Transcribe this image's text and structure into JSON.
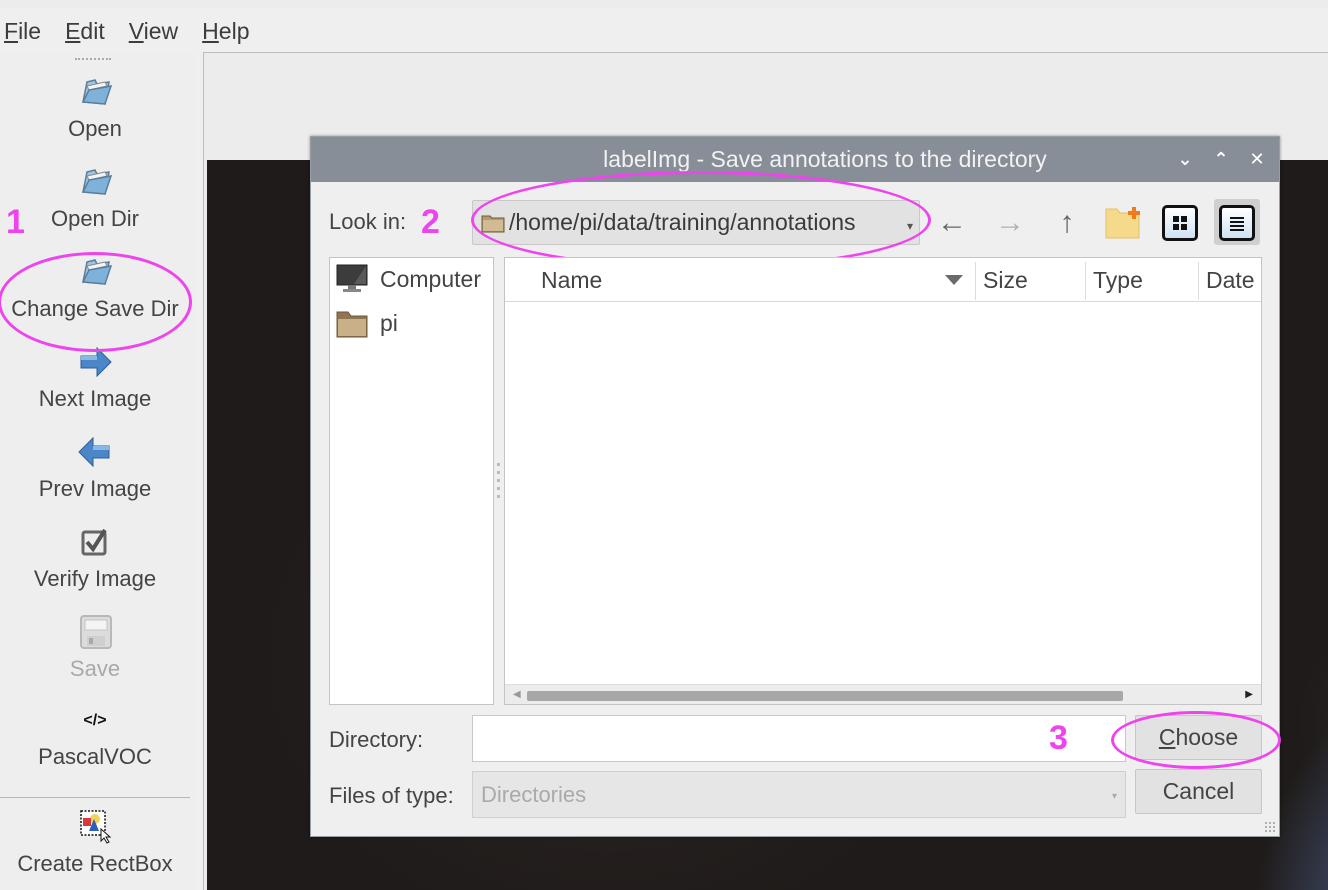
{
  "menubar": {
    "items": [
      {
        "label": "File",
        "mnemonic": "F",
        "rest": "ile"
      },
      {
        "label": "Edit",
        "mnemonic": "E",
        "rest": "dit"
      },
      {
        "label": "View",
        "mnemonic": "V",
        "rest": "iew"
      },
      {
        "label": "Help",
        "mnemonic": "H",
        "rest": "elp"
      }
    ]
  },
  "toolbar": {
    "items": [
      {
        "label": "Open",
        "icon": "folder-open-icon",
        "enabled": true
      },
      {
        "label": "Open Dir",
        "icon": "folder-open-icon",
        "enabled": true
      },
      {
        "label": "Change Save Dir",
        "icon": "folder-open-icon",
        "enabled": true
      },
      {
        "label": "Next Image",
        "icon": "arrow-right-icon",
        "enabled": true
      },
      {
        "label": "Prev Image",
        "icon": "arrow-left-icon",
        "enabled": true
      },
      {
        "label": "Verify Image",
        "icon": "checkbox-icon",
        "enabled": true
      },
      {
        "label": "Save",
        "icon": "floppy-disk-icon",
        "enabled": false
      },
      {
        "label": "PascalVOC",
        "icon": "code-tag-icon",
        "icon_text": "</>",
        "enabled": true
      },
      {
        "label": "Create RectBox",
        "icon": "create-rect-icon",
        "enabled": true
      }
    ]
  },
  "annotations": {
    "step1": "1",
    "step2": "2",
    "step3": "3",
    "color": "#ee44ee"
  },
  "dialog": {
    "title": "labelImg - Save annotations to the directory",
    "window_buttons": {
      "minimize": "⌄",
      "maximize": "⌃",
      "close": "✕"
    },
    "look_in_label": "Look in:",
    "look_in_path": "/home/pi/data/training/annotations",
    "nav": {
      "back": "←",
      "forward": "→",
      "up": "↑"
    },
    "places": [
      {
        "label": "Computer",
        "icon": "computer-icon"
      },
      {
        "label": "pi",
        "icon": "folder-icon"
      }
    ],
    "columns": [
      "Name",
      "Size",
      "Type",
      "Date"
    ],
    "directory_label": "Directory:",
    "directory_value": "",
    "files_of_type_label": "Files of type:",
    "files_of_type_value": "Directories",
    "choose_button": {
      "label": "Choose",
      "mnemonic": "C",
      "rest": "hoose"
    },
    "cancel_button": "Cancel"
  }
}
